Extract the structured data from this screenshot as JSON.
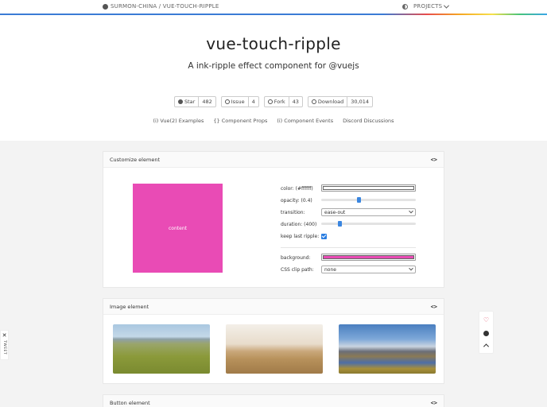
{
  "topbar": {
    "repo_label": "SURMON-CHINA / VUE-TOUCH-RIPPLE",
    "projects_label": "PROJECTS"
  },
  "hero": {
    "title": "vue-touch-ripple",
    "subtitle": "A ink-ripple effect component for @vuejs",
    "badges": [
      {
        "label": "Star",
        "count": "482",
        "icon": "github-icon"
      },
      {
        "label": "Issue",
        "count": "4",
        "icon": "issue-icon"
      },
      {
        "label": "Fork",
        "count": "43",
        "icon": "fork-icon"
      },
      {
        "label": "Download",
        "count": "30,014",
        "icon": "download-icon"
      }
    ],
    "links": [
      "(i) Vue(2) Examples",
      "{} Component Props",
      "(i) Component Events",
      "Discord Discussions"
    ]
  },
  "customize": {
    "title": "Customize element",
    "preview_text": "content",
    "color_label": "color: (#ffffff)",
    "color_value": "#ffffff",
    "opacity_label": "opacity: (0.4)",
    "opacity_value": 0.4,
    "transition_label": "transition:",
    "transition_value": "ease-out",
    "duration_label": "duration: (400)",
    "duration_value": 400,
    "keep_last_label": "keep last ripple:",
    "keep_last_checked": true,
    "background_label": "background:",
    "background_value": "#e94bb5",
    "clip_path_label": "CSS clip path:",
    "clip_path_value": "none"
  },
  "image_card": {
    "title": "Image element"
  },
  "button_card": {
    "title": "Button element"
  },
  "code_toggle": "<>",
  "tweet_label": "TWEET",
  "colors": {
    "accent": "#3a86e0",
    "preview_bg": "#e94bb5",
    "heart": "#e0506a"
  }
}
